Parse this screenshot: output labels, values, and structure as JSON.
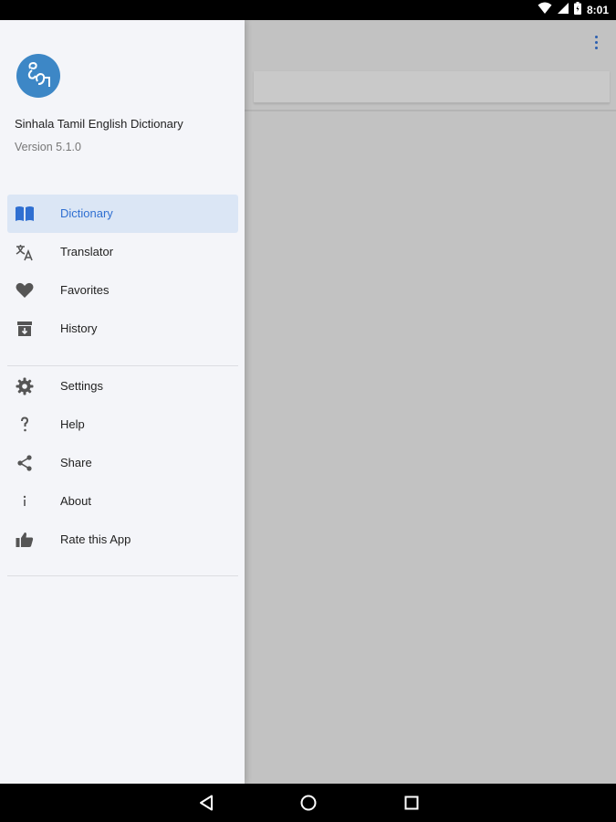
{
  "status_bar": {
    "time": "8:01"
  },
  "drawer": {
    "app_name": "Sinhala Tamil English Dictionary",
    "version": "Version 5.1.0",
    "primary_items": [
      {
        "label": "Dictionary",
        "icon": "book-icon",
        "active": true
      },
      {
        "label": "Translator",
        "icon": "translate-icon"
      },
      {
        "label": "Favorites",
        "icon": "heart-icon"
      },
      {
        "label": "History",
        "icon": "archive-icon"
      }
    ],
    "secondary_items": [
      {
        "label": "Settings",
        "icon": "gear-icon"
      },
      {
        "label": "Help",
        "icon": "help-icon"
      },
      {
        "label": "Share",
        "icon": "share-icon"
      },
      {
        "label": "About",
        "icon": "info-icon"
      },
      {
        "label": "Rate this App",
        "icon": "thumbs-up-icon"
      }
    ]
  },
  "colors": {
    "accent": "#2f6fd1",
    "active_bg": "#dbe6f5",
    "logo": "#3d87c6",
    "overlay": "#c2c2c2"
  }
}
